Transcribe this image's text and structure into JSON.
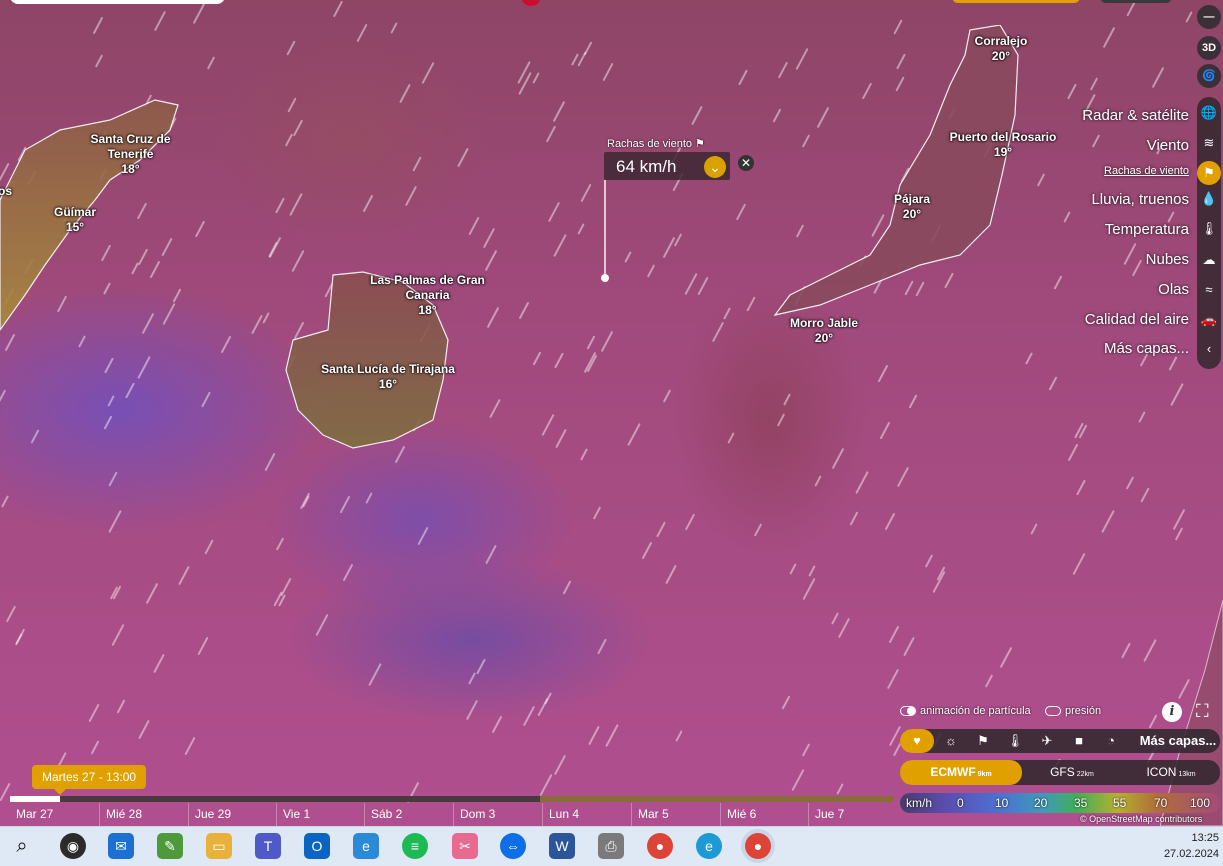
{
  "map": {
    "cities": [
      {
        "name": "Santa Cruz de Tenerife",
        "temp": "18°"
      },
      {
        "name": "Güímar",
        "temp": "15°"
      },
      {
        "name": "os",
        "temp": ""
      },
      {
        "name": "Las Palmas de Gran Canaria",
        "temp": "18°"
      },
      {
        "name": "Santa Lucía de Tirajana",
        "temp": "16°"
      },
      {
        "name": "Corralejo",
        "temp": "20°"
      },
      {
        "name": "Puerto del Rosario",
        "temp": "19°"
      },
      {
        "name": "Pájara",
        "temp": "20°"
      },
      {
        "name": "Morro Jable",
        "temp": "20°"
      }
    ],
    "gust_popup": {
      "label": "Rachas de viento",
      "value": "64 km/h"
    }
  },
  "controls": {
    "three_d": "3D",
    "layers": [
      {
        "label": "Radar & satélite",
        "icon": "globe-icon"
      },
      {
        "label": "Viento",
        "icon": "wind-icon"
      },
      {
        "label": "Rachas de viento",
        "icon": "flag-icon",
        "active": true
      },
      {
        "label": "Lluvia, truenos",
        "icon": "drop-icon"
      },
      {
        "label": "Temperatura",
        "icon": "thermometer-icon"
      },
      {
        "label": "Nubes",
        "icon": "cloud-icon"
      },
      {
        "label": "Olas",
        "icon": "waves-icon"
      },
      {
        "label": "Calidad del aire",
        "icon": "car-icon"
      },
      {
        "label": "Más capas...",
        "icon": "chevron-left-icon"
      }
    ]
  },
  "bottom": {
    "toggle_particles": "animación de partícula",
    "toggle_pressure": "presión",
    "more_layers": "Más capas...",
    "models": [
      {
        "name": "ECMWF",
        "res": "9km"
      },
      {
        "name": "GFS",
        "res": "22km"
      },
      {
        "name": "ICON",
        "res": "13km"
      }
    ],
    "legend": {
      "unit": "km/h",
      "values": [
        "0",
        "10",
        "20",
        "35",
        "55",
        "70",
        "100"
      ]
    },
    "attribution": "© OpenStreetMap contributors"
  },
  "timeline": {
    "current": "Martes 27 - 13:00",
    "days": [
      "Mar 27",
      "Mié 28",
      "Jue 29",
      "Vie 1",
      "Sáb 2",
      "Dom 3",
      "Lun 4",
      "Mar 5",
      "Mié 6",
      "Jue 7"
    ]
  },
  "taskbar": {
    "time": "13:25",
    "date": "27.02.2024"
  },
  "colors": {
    "accent": "#e0a100",
    "panel": "#3b3035"
  }
}
